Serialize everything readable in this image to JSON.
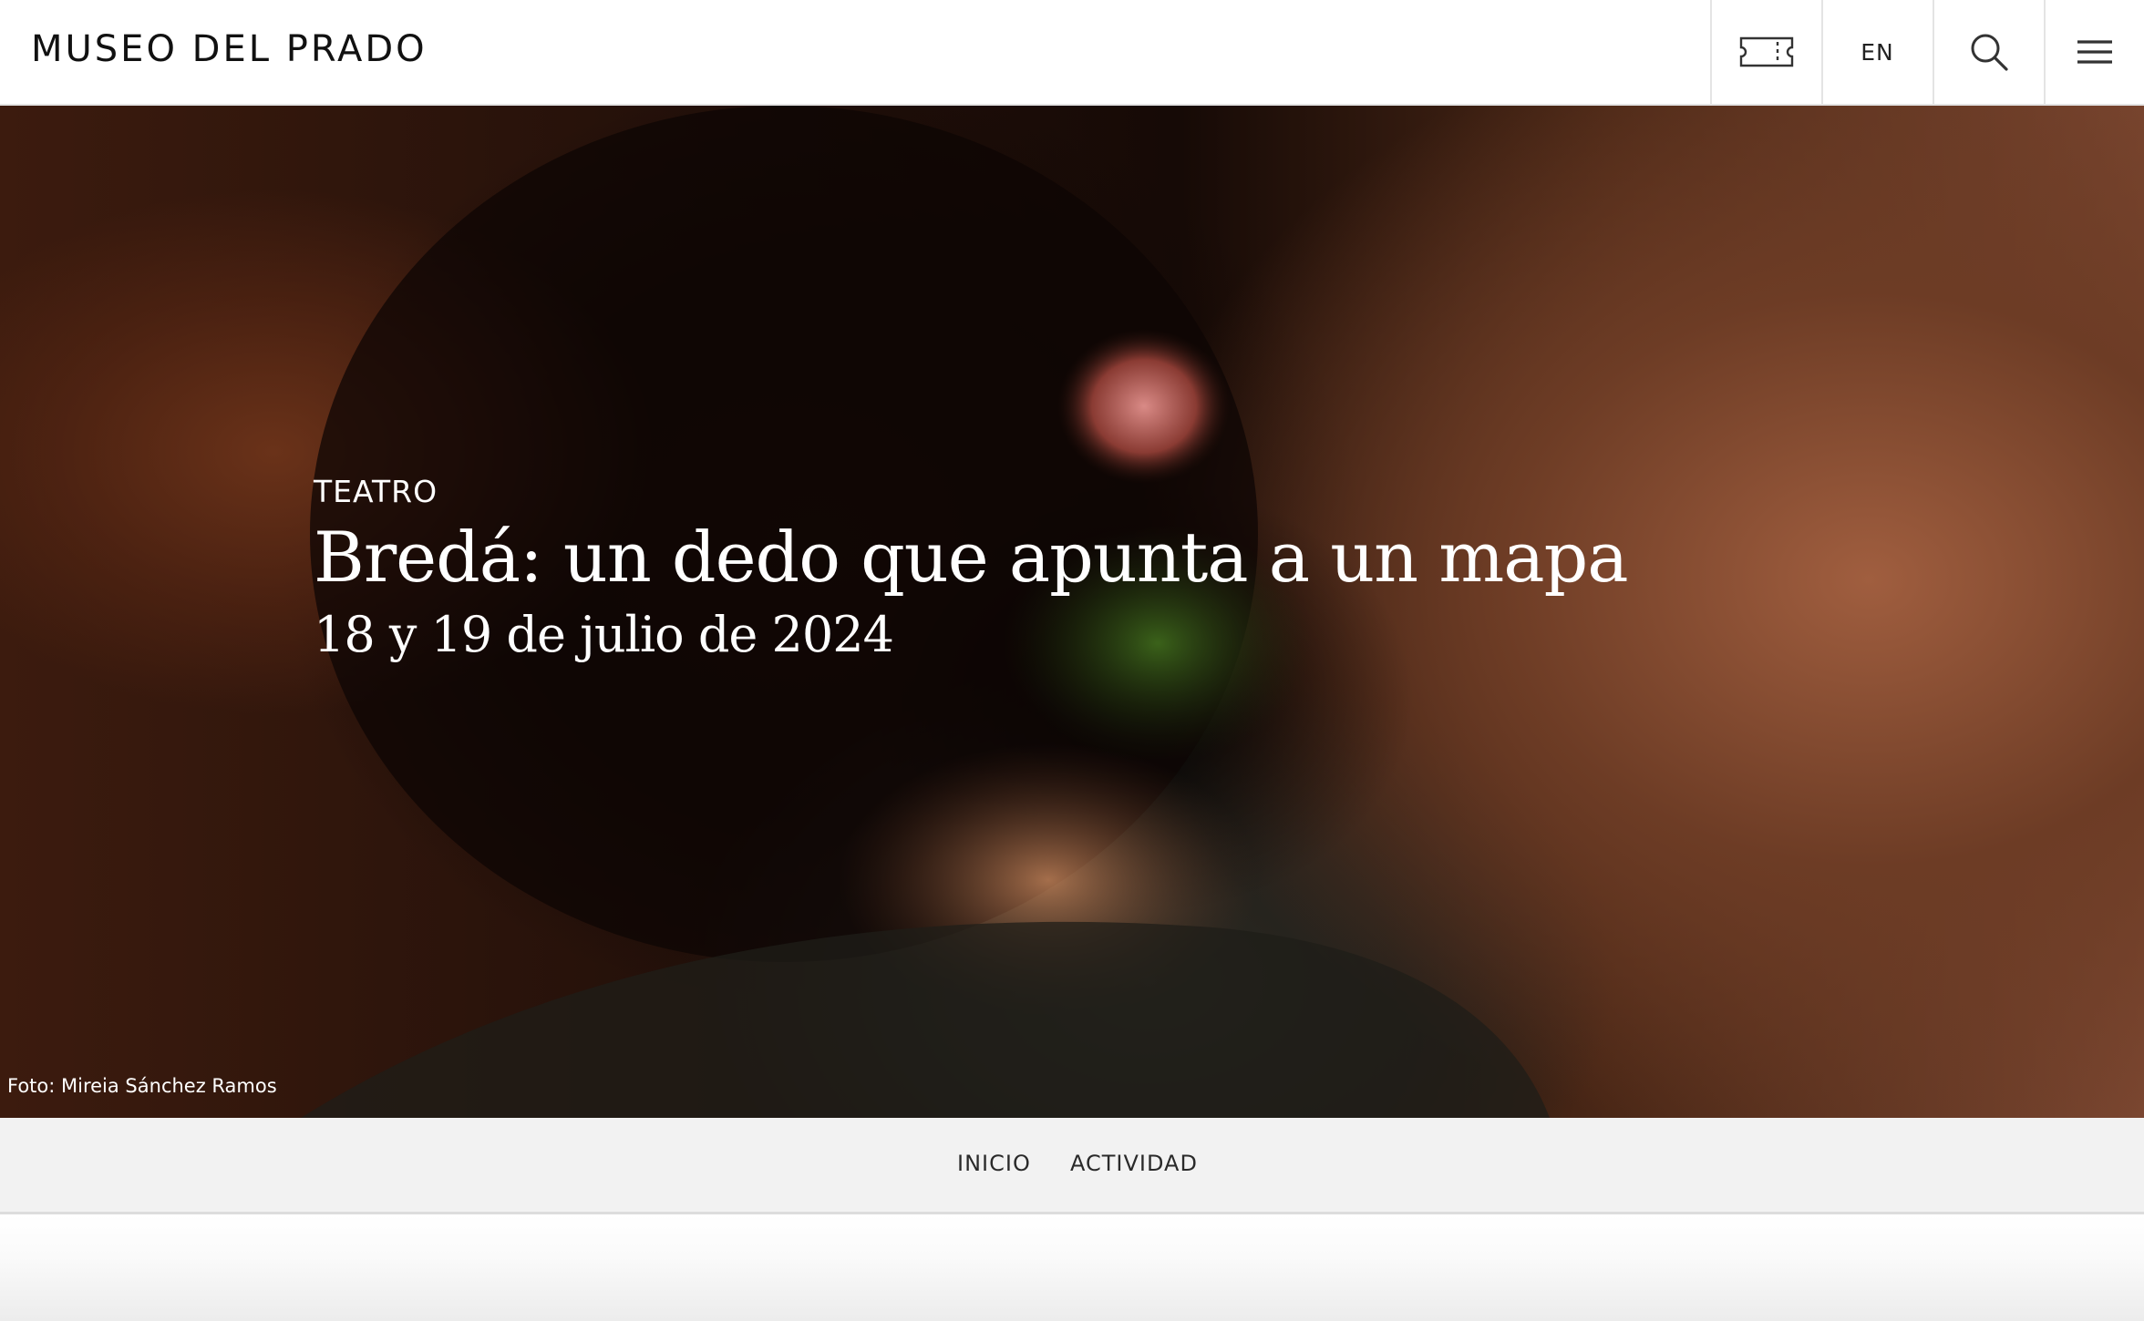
{
  "header": {
    "logo": "MUSEO DEL PRADO",
    "ticket_icon": "ticket-icon",
    "language": "EN",
    "search_icon": "search-icon",
    "menu_icon": "hamburger-menu-icon"
  },
  "hero": {
    "category": "TEATRO",
    "title": "Bredá: un dedo que apunta a un mapa",
    "date": "18 y 19 de julio de 2024",
    "photo_credit": "Foto: Mireia Sánchez Ramos"
  },
  "subnav": {
    "items": [
      "INICIO",
      "ACTIVIDAD"
    ]
  },
  "colors": {
    "header_background": "#ffffff",
    "subnav_background": "#f2f2f2",
    "text_dark": "#111111",
    "hero_text": "#ffffff"
  }
}
